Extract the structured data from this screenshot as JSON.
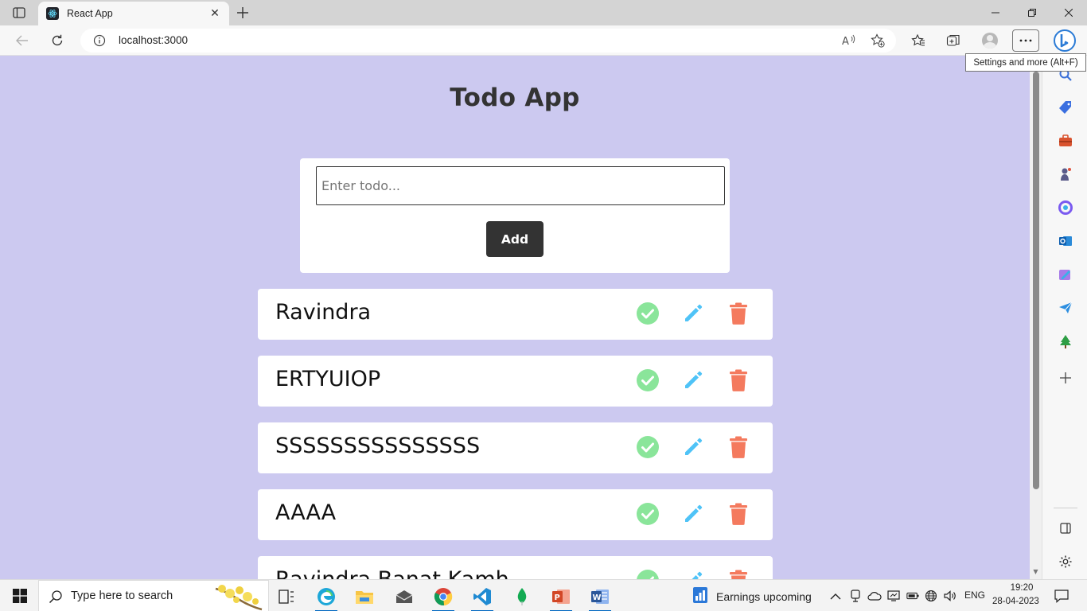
{
  "browser": {
    "tab_title": "React App",
    "url": "localhost:3000",
    "tooltip": "Settings and more (Alt+F)"
  },
  "app": {
    "title": "Todo App",
    "input_placeholder": "Enter todo...",
    "input_value": "",
    "add_label": "Add",
    "todos": [
      "Ravindra",
      "ERTYUIOP",
      "SSSSSSSSSSSSSSS",
      "AAAA",
      "Ravindra Banat Kamh"
    ],
    "colors": {
      "page_background": "#ccc9f0",
      "complete": "#8ae59a",
      "edit": "#4fc3f7",
      "delete": "#f47a5e",
      "button": "#333333"
    }
  },
  "taskbar": {
    "search_placeholder": "Type here to search",
    "news": "Earnings upcoming",
    "language": "ENG",
    "time": "19:20",
    "date": "28-04-2023"
  }
}
